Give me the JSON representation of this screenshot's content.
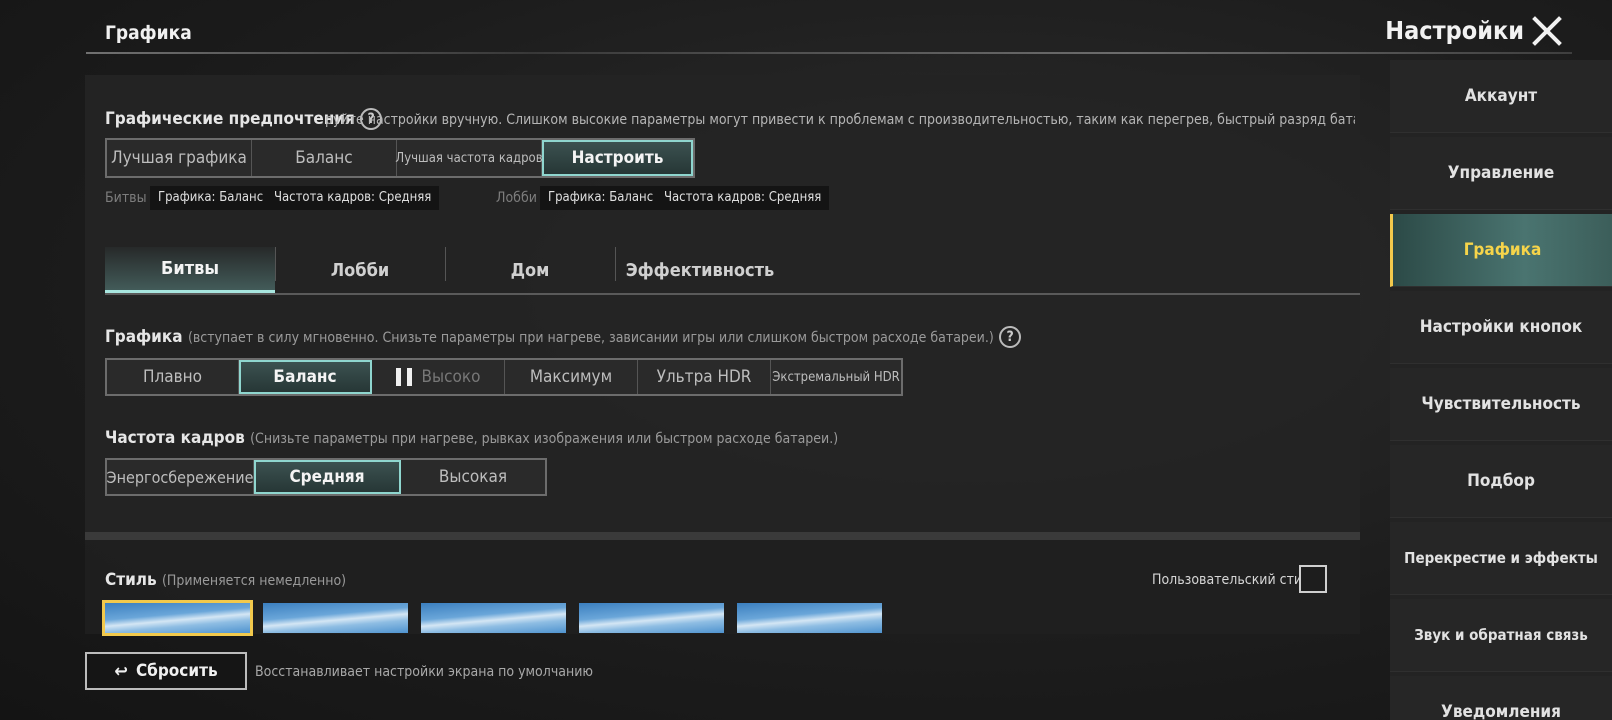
{
  "header": {
    "section_title": "Графика",
    "settings_title": "Настройки"
  },
  "prefs": {
    "label": "Графические предпочтения",
    "description": "руйте настройки вручную. Слишком высокие параметры могут привести к проблемам с производительностью, таким как перегрев, быстрый разряд батареи или подвисания",
    "options": [
      "Лучшая графика",
      "Баланс",
      "Лучшая частота кадров",
      "Настроить"
    ],
    "selected": "Настроить",
    "battles_label": "Битвы",
    "battles_tags": [
      "Графика: Баланс",
      "Частота кадров: Средняя"
    ],
    "lobby_label": "Лобби",
    "lobby_tags": [
      "Графика: Баланс",
      "Частота кадров: Средняя"
    ]
  },
  "tabs": {
    "items": [
      "Битвы",
      "Лобби",
      "Дом",
      "Эффективность"
    ],
    "active": "Битвы"
  },
  "graphics": {
    "label": "Графика",
    "hint": "(вступает в силу мгновенно. Снизьте параметры при нагреве, зависании игры или слишком быстром расходе батареи.)",
    "options": [
      "Плавно",
      "Баланс",
      "Высоко",
      "Максимум",
      "Ультра HDR",
      "Экстремальный HDR"
    ],
    "selected": "Баланс"
  },
  "fps": {
    "label": "Частота кадров",
    "hint": "(Снизьте параметры при нагреве, рывках изображения или быстром расходе батареи.)",
    "options": [
      "Энергосбережение",
      "Средняя",
      "Высокая"
    ],
    "selected": "Средняя"
  },
  "style": {
    "label": "Стиль",
    "hint": "(Применяется немедленно)",
    "custom_label": "Пользовательский стиль",
    "custom_checked": false,
    "thumb_count": 5,
    "selected_index": 0
  },
  "footer": {
    "reset_label": "Сбросить",
    "reset_desc": "Восстанавливает настройки экрана по умолчанию"
  },
  "sidebar": {
    "items": [
      "Аккаунт",
      "Управление",
      "Графика",
      "Настройки кнопок",
      "Чувствительность",
      "Подбор",
      "Перекрестие и эффекты",
      "Звук и обратная связь",
      "Уведомления"
    ],
    "active": "Графика"
  },
  "colors": {
    "accent_teal": "#8fd6cf",
    "accent_yellow": "#f2c94c"
  }
}
